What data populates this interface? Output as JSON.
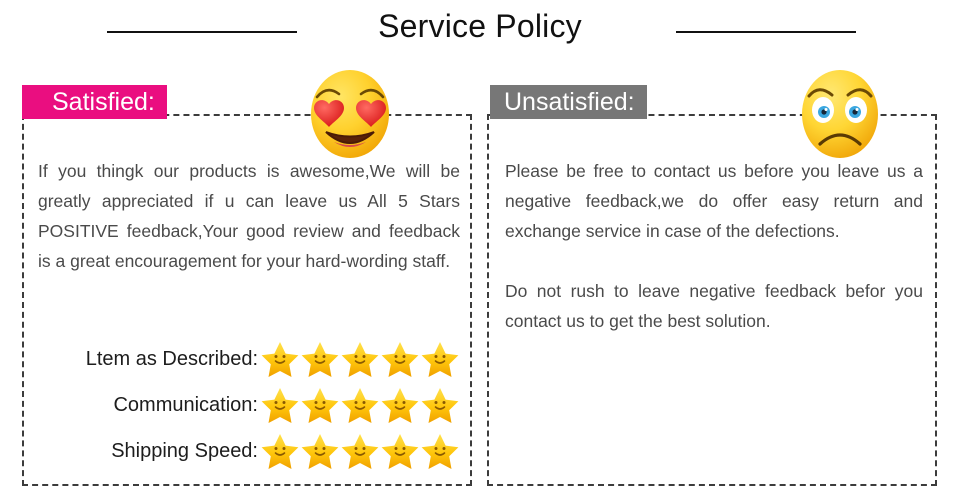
{
  "header": {
    "title": "Service Policy"
  },
  "satisfied": {
    "tag_label": "Satisfied:",
    "emoji_name": "heart-eyes-smiling-face",
    "paragraph": "If you thingk our products is awesome,We will be greatly appreciated if u can leave us All 5 Stars POSITIVE feedback,Your good review and feedback is a great encouragement for your hard-wording staff.",
    "ratings": [
      {
        "label": "Ltem as Described:",
        "stars": 5
      },
      {
        "label": "Communication:",
        "stars": 5
      },
      {
        "label": "Shipping Speed:",
        "stars": 5
      }
    ]
  },
  "unsatisfied": {
    "tag_label": "Unsatisfied:",
    "emoji_name": "worried-sad-face",
    "paragraph_1": "Please be free to contact us before you leave us a negative feedback,we do offer easy return and exchange service in case of the defections.",
    "paragraph_2": "Do not rush to leave negative feedback befor you contact us to get the best solution."
  },
  "colors": {
    "satisfied_tag_bg": "#ea0e80",
    "unsatisfied_tag_bg": "#777777",
    "star_fill": "#ffc60b",
    "border": "#3c3c3c",
    "body_text": "#4a4a4a",
    "title_text": "#111111"
  }
}
